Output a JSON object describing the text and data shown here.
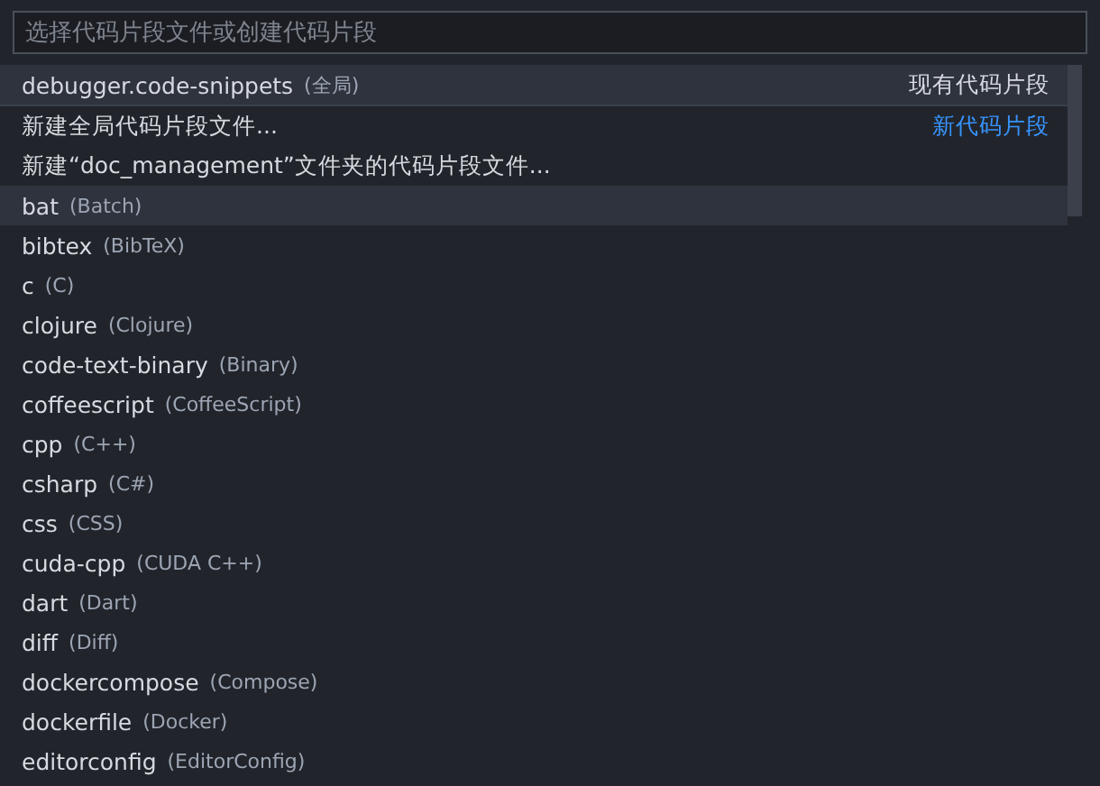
{
  "search": {
    "placeholder": "选择代码片段文件或创建代码片段"
  },
  "groups": [
    {
      "label": "现有代码片段",
      "items": [
        {
          "name": "debugger.code-snippets",
          "detail": "(全局)",
          "selected": true
        }
      ]
    },
    {
      "label": "新代码片段",
      "items": [
        {
          "name": "新建全局代码片段文件...",
          "selected": false
        },
        {
          "name": "新建“doc_management”文件夹的代码片段文件...",
          "selected": false
        }
      ]
    },
    {
      "items": [
        {
          "name": "bat",
          "detail": "(Batch)",
          "selected": true
        },
        {
          "name": "bibtex",
          "detail": "(BibTeX)",
          "selected": false
        },
        {
          "name": "c",
          "detail": "(C)",
          "selected": false
        },
        {
          "name": "clojure",
          "detail": "(Clojure)",
          "selected": false
        },
        {
          "name": "code-text-binary",
          "detail": "(Binary)",
          "selected": false
        },
        {
          "name": "coffeescript",
          "detail": "(CoffeeScript)",
          "selected": false
        },
        {
          "name": "cpp",
          "detail": "(C++)",
          "selected": false
        },
        {
          "name": "csharp",
          "detail": "(C#)",
          "selected": false
        },
        {
          "name": "css",
          "detail": "(CSS)",
          "selected": false
        },
        {
          "name": "cuda-cpp",
          "detail": "(CUDA C++)",
          "selected": false
        },
        {
          "name": "dart",
          "detail": "(Dart)",
          "selected": false
        },
        {
          "name": "diff",
          "detail": "(Diff)",
          "selected": false
        },
        {
          "name": "dockercompose",
          "detail": "(Compose)",
          "selected": false
        },
        {
          "name": "dockerfile",
          "detail": "(Docker)",
          "selected": false
        },
        {
          "name": "editorconfig",
          "detail": "(EditorConfig)",
          "selected": false
        }
      ]
    }
  ]
}
